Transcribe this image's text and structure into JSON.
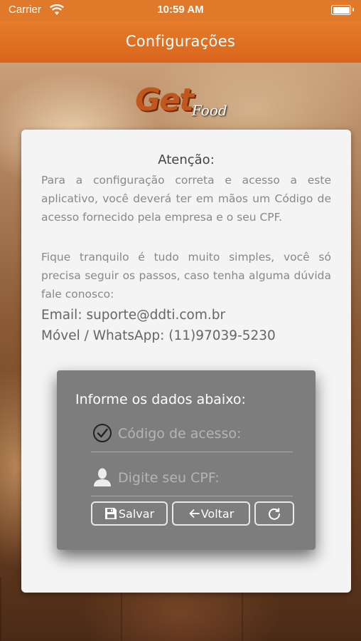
{
  "status_bar": {
    "carrier": "Carrier",
    "time": "10:59 AM"
  },
  "navbar": {
    "title": "Configurações"
  },
  "logo": {
    "main": "Get",
    "sub": "Food"
  },
  "notice": {
    "title": "Atenção:",
    "paragraph1": "Para a configuração correta e acesso a este aplicativo, você deverá ter em mãos um Código de acesso fornecido pela empresa e o seu CPF.",
    "paragraph2": "Fique tranquilo é tudo muito simples, você só precisa seguir os passos, caso tenha alguma dúvida fale conosco:",
    "email": "Email: suporte@ddti.com.br",
    "phone": "Móvel / WhatsApp: (11)97039-5230"
  },
  "dialog": {
    "title": "Informe os dados abaixo:",
    "code_field": {
      "placeholder": "Código de acesso:",
      "value": "",
      "icon": "check-circle-icon"
    },
    "cpf_field": {
      "placeholder": "Digite seu CPF:",
      "value": "",
      "icon": "user-icon"
    },
    "buttons": {
      "save_label": "Salvar",
      "back_label": "Voltar",
      "refresh_icon": "refresh-icon"
    }
  },
  "colors": {
    "accent": "#e07a2a",
    "dialog_bg": "#7d7d7d",
    "card_bg": "#f4f4f4"
  }
}
